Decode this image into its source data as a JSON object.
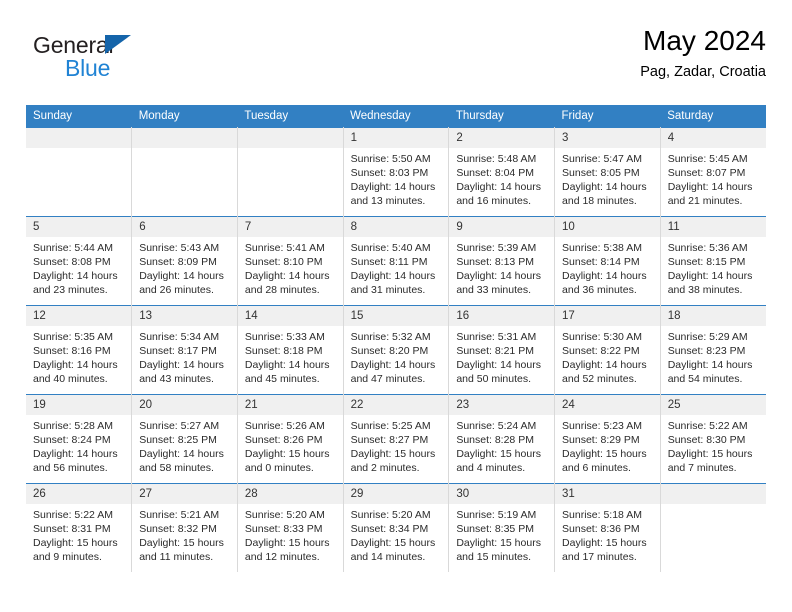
{
  "brand": {
    "name_part1": "General",
    "name_part2": "Blue"
  },
  "header": {
    "title": "May 2024",
    "subtitle": "Pag, Zadar, Croatia"
  },
  "weekday_headers": [
    "Sunday",
    "Monday",
    "Tuesday",
    "Wednesday",
    "Thursday",
    "Friday",
    "Saturday"
  ],
  "colors": {
    "header_blue": "#3280c3",
    "brand_blue": "#2083d4",
    "logo_triangle": "#1464aa",
    "daynum_band": "#f0f0f0",
    "cell_divider": "#d9d9d9"
  },
  "weeks": [
    [
      {
        "day": "",
        "empty": true
      },
      {
        "day": "",
        "empty": true
      },
      {
        "day": "",
        "empty": true
      },
      {
        "day": "1",
        "sunrise": "Sunrise: 5:50 AM",
        "sunset": "Sunset: 8:03 PM",
        "daylight1": "Daylight: 14 hours",
        "daylight2": "and 13 minutes."
      },
      {
        "day": "2",
        "sunrise": "Sunrise: 5:48 AM",
        "sunset": "Sunset: 8:04 PM",
        "daylight1": "Daylight: 14 hours",
        "daylight2": "and 16 minutes."
      },
      {
        "day": "3",
        "sunrise": "Sunrise: 5:47 AM",
        "sunset": "Sunset: 8:05 PM",
        "daylight1": "Daylight: 14 hours",
        "daylight2": "and 18 minutes."
      },
      {
        "day": "4",
        "sunrise": "Sunrise: 5:45 AM",
        "sunset": "Sunset: 8:07 PM",
        "daylight1": "Daylight: 14 hours",
        "daylight2": "and 21 minutes."
      }
    ],
    [
      {
        "day": "5",
        "sunrise": "Sunrise: 5:44 AM",
        "sunset": "Sunset: 8:08 PM",
        "daylight1": "Daylight: 14 hours",
        "daylight2": "and 23 minutes."
      },
      {
        "day": "6",
        "sunrise": "Sunrise: 5:43 AM",
        "sunset": "Sunset: 8:09 PM",
        "daylight1": "Daylight: 14 hours",
        "daylight2": "and 26 minutes."
      },
      {
        "day": "7",
        "sunrise": "Sunrise: 5:41 AM",
        "sunset": "Sunset: 8:10 PM",
        "daylight1": "Daylight: 14 hours",
        "daylight2": "and 28 minutes."
      },
      {
        "day": "8",
        "sunrise": "Sunrise: 5:40 AM",
        "sunset": "Sunset: 8:11 PM",
        "daylight1": "Daylight: 14 hours",
        "daylight2": "and 31 minutes."
      },
      {
        "day": "9",
        "sunrise": "Sunrise: 5:39 AM",
        "sunset": "Sunset: 8:13 PM",
        "daylight1": "Daylight: 14 hours",
        "daylight2": "and 33 minutes."
      },
      {
        "day": "10",
        "sunrise": "Sunrise: 5:38 AM",
        "sunset": "Sunset: 8:14 PM",
        "daylight1": "Daylight: 14 hours",
        "daylight2": "and 36 minutes."
      },
      {
        "day": "11",
        "sunrise": "Sunrise: 5:36 AM",
        "sunset": "Sunset: 8:15 PM",
        "daylight1": "Daylight: 14 hours",
        "daylight2": "and 38 minutes."
      }
    ],
    [
      {
        "day": "12",
        "sunrise": "Sunrise: 5:35 AM",
        "sunset": "Sunset: 8:16 PM",
        "daylight1": "Daylight: 14 hours",
        "daylight2": "and 40 minutes."
      },
      {
        "day": "13",
        "sunrise": "Sunrise: 5:34 AM",
        "sunset": "Sunset: 8:17 PM",
        "daylight1": "Daylight: 14 hours",
        "daylight2": "and 43 minutes."
      },
      {
        "day": "14",
        "sunrise": "Sunrise: 5:33 AM",
        "sunset": "Sunset: 8:18 PM",
        "daylight1": "Daylight: 14 hours",
        "daylight2": "and 45 minutes."
      },
      {
        "day": "15",
        "sunrise": "Sunrise: 5:32 AM",
        "sunset": "Sunset: 8:20 PM",
        "daylight1": "Daylight: 14 hours",
        "daylight2": "and 47 minutes."
      },
      {
        "day": "16",
        "sunrise": "Sunrise: 5:31 AM",
        "sunset": "Sunset: 8:21 PM",
        "daylight1": "Daylight: 14 hours",
        "daylight2": "and 50 minutes."
      },
      {
        "day": "17",
        "sunrise": "Sunrise: 5:30 AM",
        "sunset": "Sunset: 8:22 PM",
        "daylight1": "Daylight: 14 hours",
        "daylight2": "and 52 minutes."
      },
      {
        "day": "18",
        "sunrise": "Sunrise: 5:29 AM",
        "sunset": "Sunset: 8:23 PM",
        "daylight1": "Daylight: 14 hours",
        "daylight2": "and 54 minutes."
      }
    ],
    [
      {
        "day": "19",
        "sunrise": "Sunrise: 5:28 AM",
        "sunset": "Sunset: 8:24 PM",
        "daylight1": "Daylight: 14 hours",
        "daylight2": "and 56 minutes."
      },
      {
        "day": "20",
        "sunrise": "Sunrise: 5:27 AM",
        "sunset": "Sunset: 8:25 PM",
        "daylight1": "Daylight: 14 hours",
        "daylight2": "and 58 minutes."
      },
      {
        "day": "21",
        "sunrise": "Sunrise: 5:26 AM",
        "sunset": "Sunset: 8:26 PM",
        "daylight1": "Daylight: 15 hours",
        "daylight2": "and 0 minutes."
      },
      {
        "day": "22",
        "sunrise": "Sunrise: 5:25 AM",
        "sunset": "Sunset: 8:27 PM",
        "daylight1": "Daylight: 15 hours",
        "daylight2": "and 2 minutes."
      },
      {
        "day": "23",
        "sunrise": "Sunrise: 5:24 AM",
        "sunset": "Sunset: 8:28 PM",
        "daylight1": "Daylight: 15 hours",
        "daylight2": "and 4 minutes."
      },
      {
        "day": "24",
        "sunrise": "Sunrise: 5:23 AM",
        "sunset": "Sunset: 8:29 PM",
        "daylight1": "Daylight: 15 hours",
        "daylight2": "and 6 minutes."
      },
      {
        "day": "25",
        "sunrise": "Sunrise: 5:22 AM",
        "sunset": "Sunset: 8:30 PM",
        "daylight1": "Daylight: 15 hours",
        "daylight2": "and 7 minutes."
      }
    ],
    [
      {
        "day": "26",
        "sunrise": "Sunrise: 5:22 AM",
        "sunset": "Sunset: 8:31 PM",
        "daylight1": "Daylight: 15 hours",
        "daylight2": "and 9 minutes."
      },
      {
        "day": "27",
        "sunrise": "Sunrise: 5:21 AM",
        "sunset": "Sunset: 8:32 PM",
        "daylight1": "Daylight: 15 hours",
        "daylight2": "and 11 minutes."
      },
      {
        "day": "28",
        "sunrise": "Sunrise: 5:20 AM",
        "sunset": "Sunset: 8:33 PM",
        "daylight1": "Daylight: 15 hours",
        "daylight2": "and 12 minutes."
      },
      {
        "day": "29",
        "sunrise": "Sunrise: 5:20 AM",
        "sunset": "Sunset: 8:34 PM",
        "daylight1": "Daylight: 15 hours",
        "daylight2": "and 14 minutes."
      },
      {
        "day": "30",
        "sunrise": "Sunrise: 5:19 AM",
        "sunset": "Sunset: 8:35 PM",
        "daylight1": "Daylight: 15 hours",
        "daylight2": "and 15 minutes."
      },
      {
        "day": "31",
        "sunrise": "Sunrise: 5:18 AM",
        "sunset": "Sunset: 8:36 PM",
        "daylight1": "Daylight: 15 hours",
        "daylight2": "and 17 minutes."
      },
      {
        "day": "",
        "empty": true
      }
    ]
  ]
}
